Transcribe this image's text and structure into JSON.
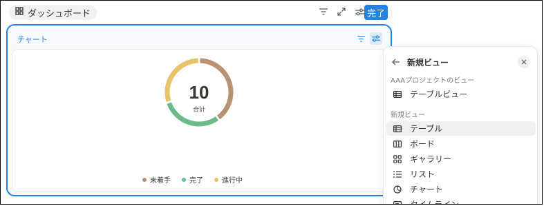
{
  "toolbar": {
    "dashboard_label": "ダッシュボード",
    "done_label": "完了"
  },
  "block": {
    "title": "チャート"
  },
  "chart_data": {
    "type": "pie",
    "center_value": "10",
    "center_label": "合計",
    "series": [
      {
        "name": "未着手",
        "value": 4,
        "color": "#b89273"
      },
      {
        "name": "完了",
        "value": 3,
        "color": "#6cb98a"
      },
      {
        "name": "進行中",
        "value": 3,
        "color": "#e8c36a"
      }
    ]
  },
  "panel": {
    "title": "新規ビュー",
    "section1_label": "AAAプロジェクトのビュー",
    "section1_items": [
      {
        "label": "テーブルビュー",
        "icon": "table-icon"
      }
    ],
    "section2_label": "新規ビュー",
    "section2_items": [
      {
        "label": "テーブル",
        "icon": "table-icon"
      },
      {
        "label": "ボード",
        "icon": "board-icon"
      },
      {
        "label": "ギャラリー",
        "icon": "gallery-icon"
      },
      {
        "label": "リスト",
        "icon": "list-icon"
      },
      {
        "label": "チャート",
        "icon": "chart-icon"
      },
      {
        "label": "タイムライン",
        "icon": "timeline-icon"
      }
    ]
  }
}
